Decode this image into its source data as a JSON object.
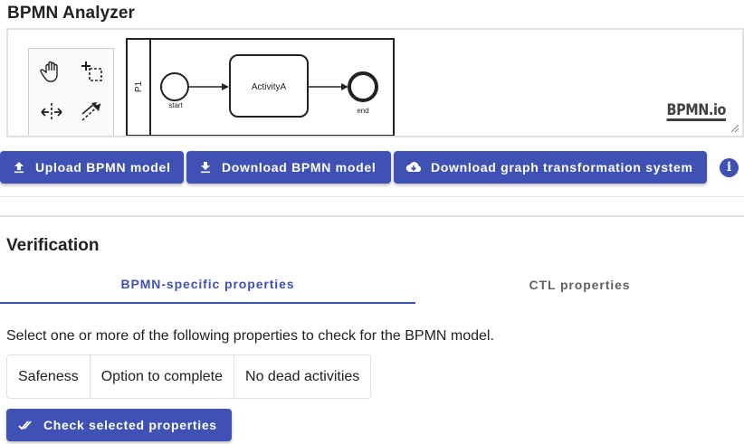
{
  "app": {
    "title": "BPMN Analyzer"
  },
  "diagram": {
    "pool_label": "P1",
    "start_label": "start",
    "activity_label": "ActivityA",
    "end_label": "end",
    "watermark": "BPMN.io",
    "palette_tools": [
      "hand-tool",
      "lasso-tool",
      "space-tool",
      "global-connect-tool"
    ]
  },
  "toolbar": {
    "upload_label": "Upload BPMN model",
    "download_label": "Download BPMN model",
    "download_gts_label": "Download graph transformation system",
    "info_label": "i"
  },
  "verification": {
    "title": "Verification",
    "tabs": [
      {
        "label": "BPMN-specific properties",
        "active": true
      },
      {
        "label": "CTL properties",
        "active": false
      }
    ],
    "instruction": "Select one or more of the following properties to check for the BPMN model.",
    "properties": [
      "Safeness",
      "Option to complete",
      "No dead activities"
    ],
    "check_label": "Check selected properties"
  },
  "colors": {
    "primary": "#3f51b5",
    "tab_inactive": "#616161",
    "border": "#e0e0e0"
  }
}
